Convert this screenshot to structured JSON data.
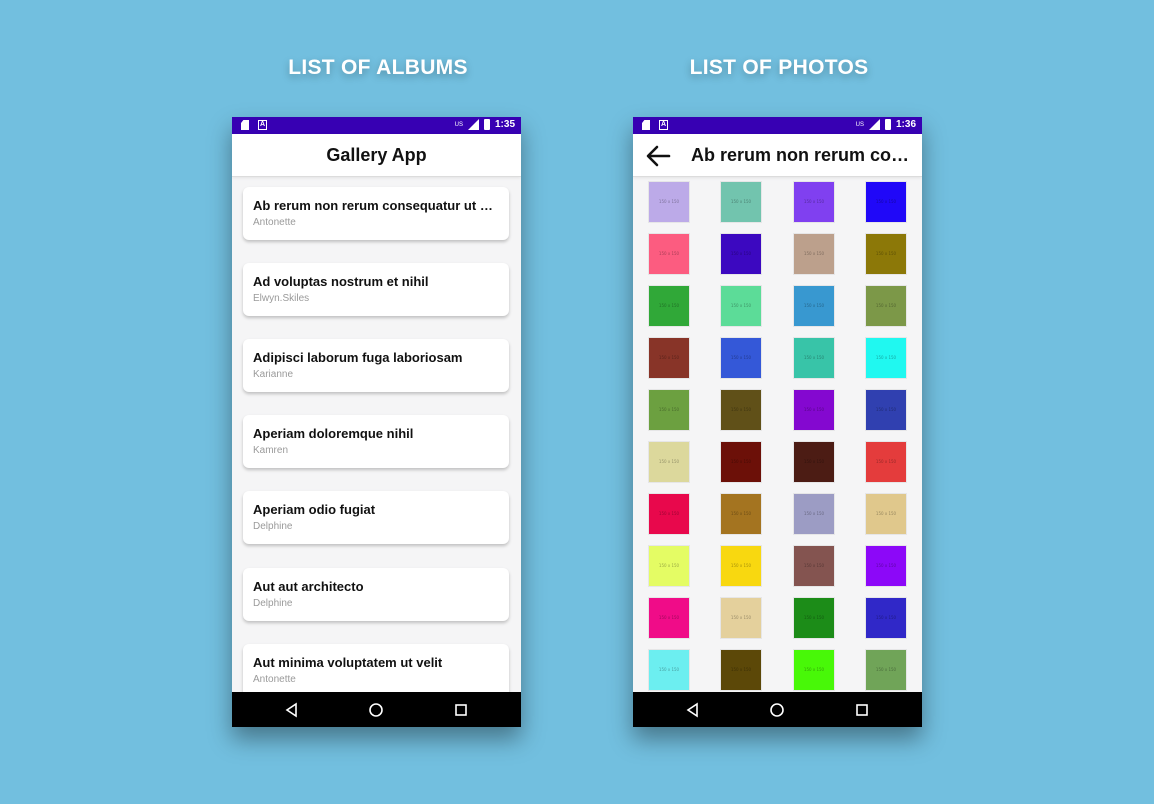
{
  "captions": {
    "left": "LIST OF ALBUMS",
    "right": "LIST OF PHOTOS"
  },
  "status_bar": {
    "left_phone_time": "1:35",
    "right_phone_time": "1:36",
    "carrier_label": "US"
  },
  "albums_screen": {
    "title": "Gallery App",
    "albums": [
      {
        "title": "Ab rerum non rerum consequatur ut ea unde",
        "user": "Antonette"
      },
      {
        "title": "Ad voluptas nostrum et nihil",
        "user": "Elwyn.Skiles"
      },
      {
        "title": "Adipisci laborum fuga laboriosam",
        "user": "Karianne"
      },
      {
        "title": "Aperiam doloremque nihil",
        "user": "Kamren"
      },
      {
        "title": "Aperiam odio fugiat",
        "user": "Delphine"
      },
      {
        "title": "Aut aut architecto",
        "user": "Delphine"
      },
      {
        "title": "Aut minima voluptatem ut velit",
        "user": "Antonette"
      }
    ]
  },
  "photos_screen": {
    "title": "Ab rerum non rerum consequatur ut ea unde",
    "placeholder_text": "150 x 150",
    "photo_colors": [
      "#bcaae8",
      "#72c4ae",
      "#8040f0",
      "#2008f8",
      "#fc5c80",
      "#3c08c0",
      "#bca08c",
      "#8c7808",
      "#30a838",
      "#5cdc98",
      "#3898d0",
      "#7c9848",
      "#883428",
      "#3458d8",
      "#38c4a8",
      "#20f8f0",
      "#6ca040",
      "#605018",
      "#8408d0",
      "#3040b0",
      "#dcd89c",
      "#6c1008",
      "#4c1c14",
      "#e43c3c",
      "#e8084c",
      "#a47420",
      "#9c9cc4",
      "#e0c88c",
      "#e4fc64",
      "#f8d810",
      "#845450",
      "#8c08f8",
      "#f00c88",
      "#e4d09c",
      "#1c8c18",
      "#3028c8",
      "#6ceef0",
      "#5c4808",
      "#48f808",
      "#70a458"
    ]
  },
  "nav_bar": {
    "icons": [
      "back-triangle",
      "home-circle",
      "recent-square"
    ]
  },
  "colors": {
    "background": "#72bfdf",
    "status_bar": "#3700b3",
    "app_bar": "#ffffff",
    "nav_bar": "#000000"
  }
}
